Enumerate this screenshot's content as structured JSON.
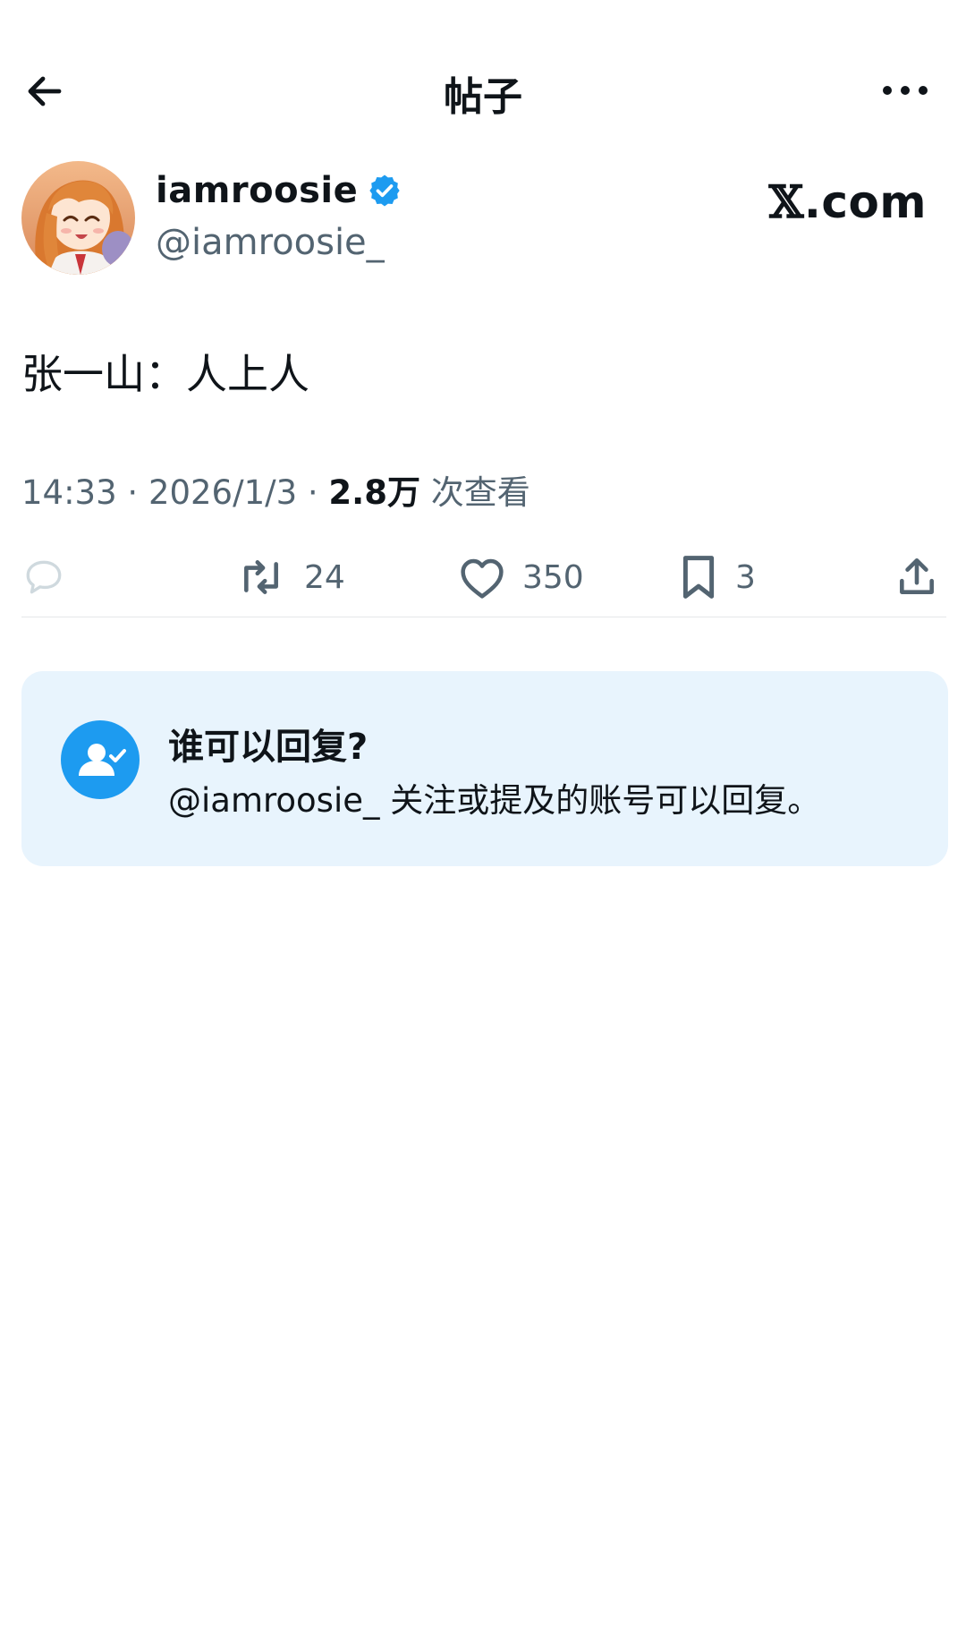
{
  "header": {
    "title": "帖子",
    "back_icon": "arrow-left-icon",
    "more_icon": "more-horizontal-icon"
  },
  "author": {
    "display_name": "iamroosie",
    "handle": "@iamroosie_",
    "verified_icon": "verified-badge-icon",
    "avatar": "anime-girl-avatar"
  },
  "brand": {
    "logo_x": "𝕏",
    "logo_suffix": ".com"
  },
  "post": {
    "text": "张一山：人上人"
  },
  "meta": {
    "time": "14:33",
    "date": "2026/1/3",
    "views": "2.8万",
    "views_label": "次查看"
  },
  "actions": {
    "reply": {
      "icon": "reply-icon",
      "count": ""
    },
    "repost": {
      "icon": "repost-icon",
      "count": "24"
    },
    "like": {
      "icon": "heart-icon",
      "count": "350"
    },
    "bookmark": {
      "icon": "bookmark-icon",
      "count": "3"
    },
    "share": {
      "icon": "share-icon"
    }
  },
  "reply_restriction": {
    "icon": "user-check-icon",
    "title": "谁可以回复?",
    "description": "@iamroosie_ 关注或提及的账号可以回复。"
  },
  "colors": {
    "accent": "#1d9bf0",
    "card_background": "#e8f4fd",
    "secondary_text": "#536471",
    "primary_text": "#0f1419"
  }
}
